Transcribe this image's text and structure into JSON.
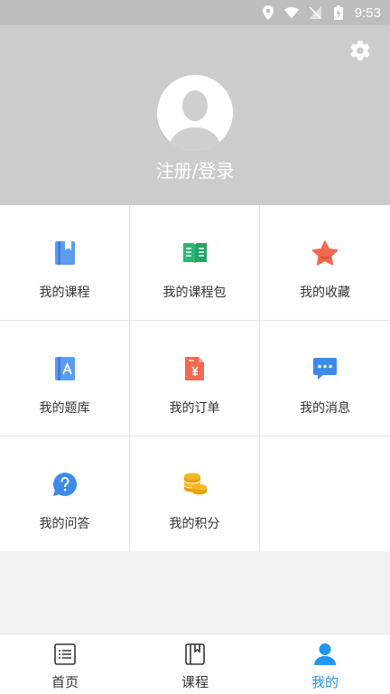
{
  "status_bar": {
    "time": "9:53"
  },
  "header": {
    "login_label": "注册/登录"
  },
  "grid": {
    "items": [
      {
        "label": "我的课程",
        "icon": "course-book-icon"
      },
      {
        "label": "我的课程包",
        "icon": "course-package-icon"
      },
      {
        "label": "我的收藏",
        "icon": "star-icon"
      },
      {
        "label": "我的题库",
        "icon": "question-bank-icon"
      },
      {
        "label": "我的订单",
        "icon": "order-icon"
      },
      {
        "label": "我的消息",
        "icon": "message-icon"
      },
      {
        "label": "我的问答",
        "icon": "qa-icon"
      },
      {
        "label": "我的积分",
        "icon": "points-coins-icon"
      }
    ]
  },
  "tabbar": {
    "tabs": [
      {
        "label": "首页",
        "icon": "home-list-icon"
      },
      {
        "label": "课程",
        "icon": "course-icon"
      },
      {
        "label": "我的",
        "icon": "profile-icon"
      }
    ],
    "active_color": "#2196f3"
  }
}
